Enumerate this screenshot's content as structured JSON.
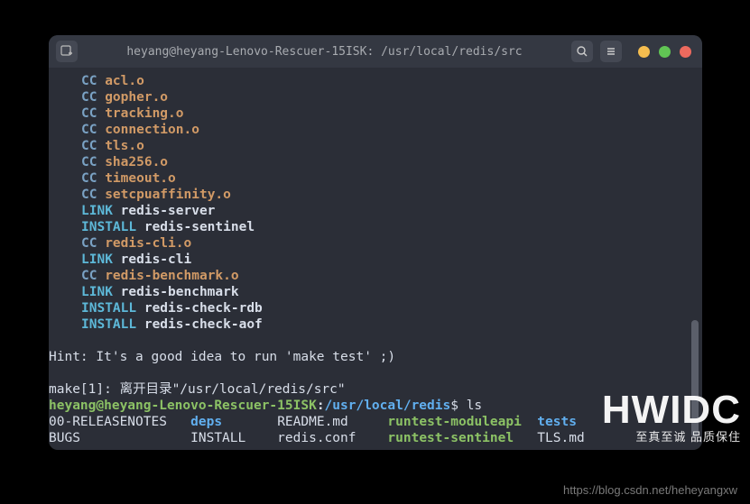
{
  "titlebar": {
    "title": "heyang@heyang-Lenovo-Rescuer-15ISK: /usr/local/redis/src"
  },
  "lines": [
    {
      "c": "cc",
      "t": "CC",
      "f": "acl.o"
    },
    {
      "c": "cc",
      "t": "CC",
      "f": "gopher.o"
    },
    {
      "c": "cc",
      "t": "CC",
      "f": "tracking.o"
    },
    {
      "c": "cc",
      "t": "CC",
      "f": "connection.o"
    },
    {
      "c": "cc",
      "t": "CC",
      "f": "tls.o"
    },
    {
      "c": "cc",
      "t": "CC",
      "f": "sha256.o"
    },
    {
      "c": "cc",
      "t": "CC",
      "f": "timeout.o"
    },
    {
      "c": "cc",
      "t": "CC",
      "f": "setcpuaffinity.o"
    },
    {
      "c": "link",
      "t": "LINK",
      "f": "redis-server"
    },
    {
      "c": "install",
      "t": "INSTALL",
      "f": "redis-sentinel"
    },
    {
      "c": "cc",
      "t": "CC",
      "f": "redis-cli.o"
    },
    {
      "c": "link",
      "t": "LINK",
      "f": "redis-cli"
    },
    {
      "c": "cc",
      "t": "CC",
      "f": "redis-benchmark.o"
    },
    {
      "c": "link",
      "t": "LINK",
      "f": "redis-benchmark"
    },
    {
      "c": "install",
      "t": "INSTALL",
      "f": "redis-check-rdb"
    },
    {
      "c": "install",
      "t": "INSTALL",
      "f": "redis-check-aof"
    }
  ],
  "hint": "Hint: It's a good idea to run 'make test' ;)",
  "make_leave": "make[1]: 离开目录\"/usr/local/redis/src\"",
  "prompt": {
    "user": "heyang@heyang-Lenovo-Rescuer-15ISK",
    "colon": ":",
    "path": "/usr/local/redis",
    "cmd": "$ ls"
  },
  "ls_row1": {
    "c1": "00-RELEASENOTES",
    "c2": "deps",
    "c3": "README.md",
    "c4": "runtest-moduleapi",
    "c5": "tests"
  },
  "ls_row2": {
    "c1": "BUGS",
    "c2": "INSTALL",
    "c3": "redis.conf",
    "c4": "runtest-sentinel",
    "c5": "TLS.md"
  },
  "watermark": {
    "brand": "HWIDC",
    "tagline": "至真至诚 品质保住"
  },
  "footer": "https://blog.csdn.net/heheyangxw"
}
